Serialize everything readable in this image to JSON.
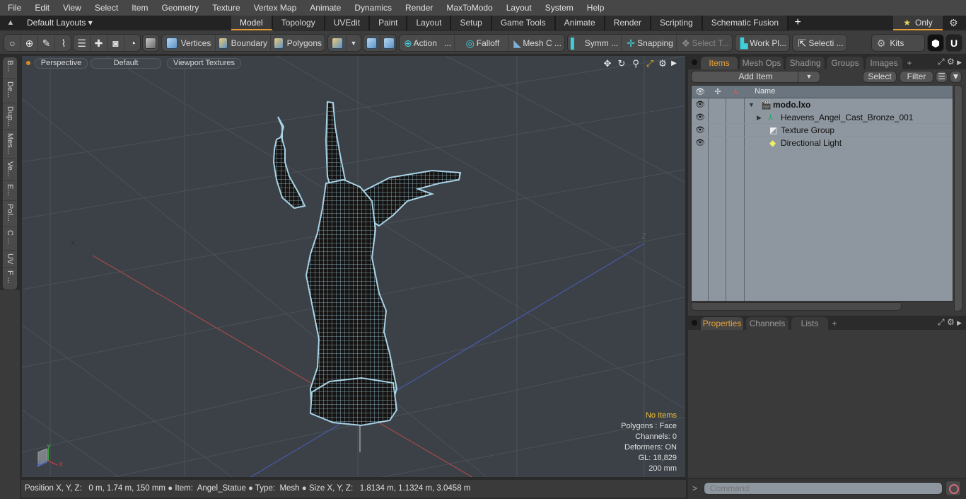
{
  "menu": [
    "File",
    "Edit",
    "View",
    "Select",
    "Item",
    "Geometry",
    "Texture",
    "Vertex Map",
    "Animate",
    "Dynamics",
    "Render",
    "MaxToModo",
    "Layout",
    "System",
    "Help"
  ],
  "layoutbar": {
    "layouts_label": "Default Layouts ▾",
    "tabs": [
      "Model",
      "Topology",
      "UVEdit",
      "Paint",
      "Layout",
      "Setup",
      "Game Tools",
      "Animate",
      "Render",
      "Scripting",
      "Schematic Fusion"
    ],
    "active_tab": "Model",
    "add_tab": "+",
    "only_label": "Only",
    "accent_color": "#e59b3a"
  },
  "toolbar": {
    "vertices": "Vertices",
    "boundary": "Boundary",
    "polygons": "Polygons",
    "action": "Action",
    "action_more": "...",
    "falloff": "Falloff",
    "mesh_c": "Mesh C ...",
    "symm": "Symm ...",
    "snapping": "Snapping",
    "select_t": "Select T...",
    "work_pl": "Work Pl...",
    "selecti": "Selecti ...",
    "kits": "Kits"
  },
  "left_tabs": [
    "B...",
    "De...",
    "Dup...",
    "Mes...",
    "Ve...",
    "E...",
    "Pol...",
    "C ...",
    "UV",
    "F ..."
  ],
  "viewport": {
    "perspective": "Perspective",
    "shading": "Default",
    "textures": "Viewport Textures",
    "axis_neg_x": "-X",
    "axis_z": "Z",
    "info": {
      "selection": "No Items",
      "polygons": "Polygons : Face",
      "channels": "Channels: 0",
      "deformers": "Deformers: ON",
      "gl": "GL: 18,829",
      "scale": "200 mm"
    },
    "gizmo": {
      "x": "X",
      "y": "Y",
      "z": "Z"
    }
  },
  "items_panel": {
    "tabs": [
      "Items",
      "Mesh Ops",
      "Shading",
      "Groups",
      "Images"
    ],
    "active_tab": "Items",
    "add_item": "Add Item",
    "select": "Select",
    "filter": "Filter",
    "column_name": "Name",
    "rows": [
      {
        "name": "modo.lxo",
        "icon": "scene-icon",
        "bold": true
      },
      {
        "name": "Heavens_Angel_Cast_Bronze_001",
        "icon": "mesh-locator-icon",
        "bold": false
      },
      {
        "name": "Texture Group",
        "icon": "texture-group-icon",
        "bold": false
      },
      {
        "name": "Directional Light",
        "icon": "light-icon",
        "bold": false
      }
    ]
  },
  "properties_panel": {
    "tabs": [
      "Properties",
      "Channels",
      "Lists"
    ],
    "active_tab": "Properties"
  },
  "statusbar": {
    "position_label": "Position X, Y, Z:",
    "position_value": "0 m, 1.74 m, 150 mm",
    "item_label": "Item:",
    "item_value": "Angel_Statue",
    "type_label": "Type:",
    "type_value": "Mesh",
    "size_label": "Size X, Y, Z:",
    "size_value": "1.8134 m, 1.1324 m, 3.0458 m"
  },
  "command": {
    "prompt": ">",
    "placeholder": "Command"
  }
}
